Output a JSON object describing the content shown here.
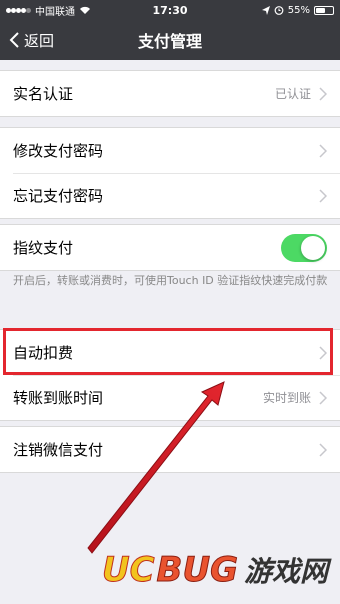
{
  "status_bar": {
    "carrier": "中国联通",
    "time": "17:30",
    "battery_text": "55%",
    "battery_level": 0.55
  },
  "nav": {
    "back_label": "返回",
    "title": "支付管理"
  },
  "groups": [
    {
      "rows": [
        {
          "label": "实名认证",
          "value": "已认证"
        }
      ]
    },
    {
      "rows": [
        {
          "label": "修改支付密码"
        },
        {
          "label": "忘记支付密码"
        }
      ]
    },
    {
      "rows": [
        {
          "label": "指纹支付",
          "toggle_on": true
        }
      ]
    },
    {
      "rows": [
        {
          "label": "自动扣费"
        },
        {
          "label": "转账到账时间",
          "value": "实时到账"
        }
      ]
    },
    {
      "rows": [
        {
          "label": "注销微信支付"
        }
      ]
    }
  ],
  "hint_text": "开启后，转账或消费时，可使用Touch ID 验证指纹快速完成付款",
  "watermark": {
    "part1": "UC",
    "part2": "BUG",
    "part3": "游戏网"
  },
  "colors": {
    "nav_bg": "#393a3f",
    "toggle_on": "#4cd964",
    "highlight": "#e3262e"
  }
}
